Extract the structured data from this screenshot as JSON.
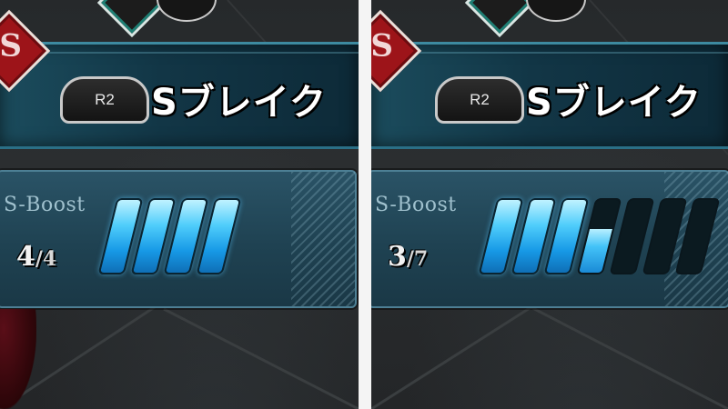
{
  "panels": [
    {
      "id": "left",
      "action_button": "R2",
      "action_label": "Sブレイク",
      "emblem_letter": "S",
      "boost": {
        "title": "S-Boost",
        "current": "4",
        "separator": "/",
        "max": "4",
        "fill_levels": [
          1,
          1,
          1,
          1
        ]
      }
    },
    {
      "id": "right",
      "action_button": "R2",
      "action_label": "Sブレイク",
      "emblem_letter": "S",
      "boost": {
        "title": "S-Boost",
        "current": "3",
        "separator": "/",
        "max": "7",
        "fill_levels": [
          1,
          1,
          1,
          0.6,
          0,
          0,
          0
        ]
      }
    }
  ],
  "colors": {
    "band": "#123646",
    "band_border": "#3d8aa0",
    "boost_box": "#1f4252",
    "bar_full": "#1799e6",
    "bar_empty": "#0b1a20",
    "emblem_red": "#9d1419"
  }
}
